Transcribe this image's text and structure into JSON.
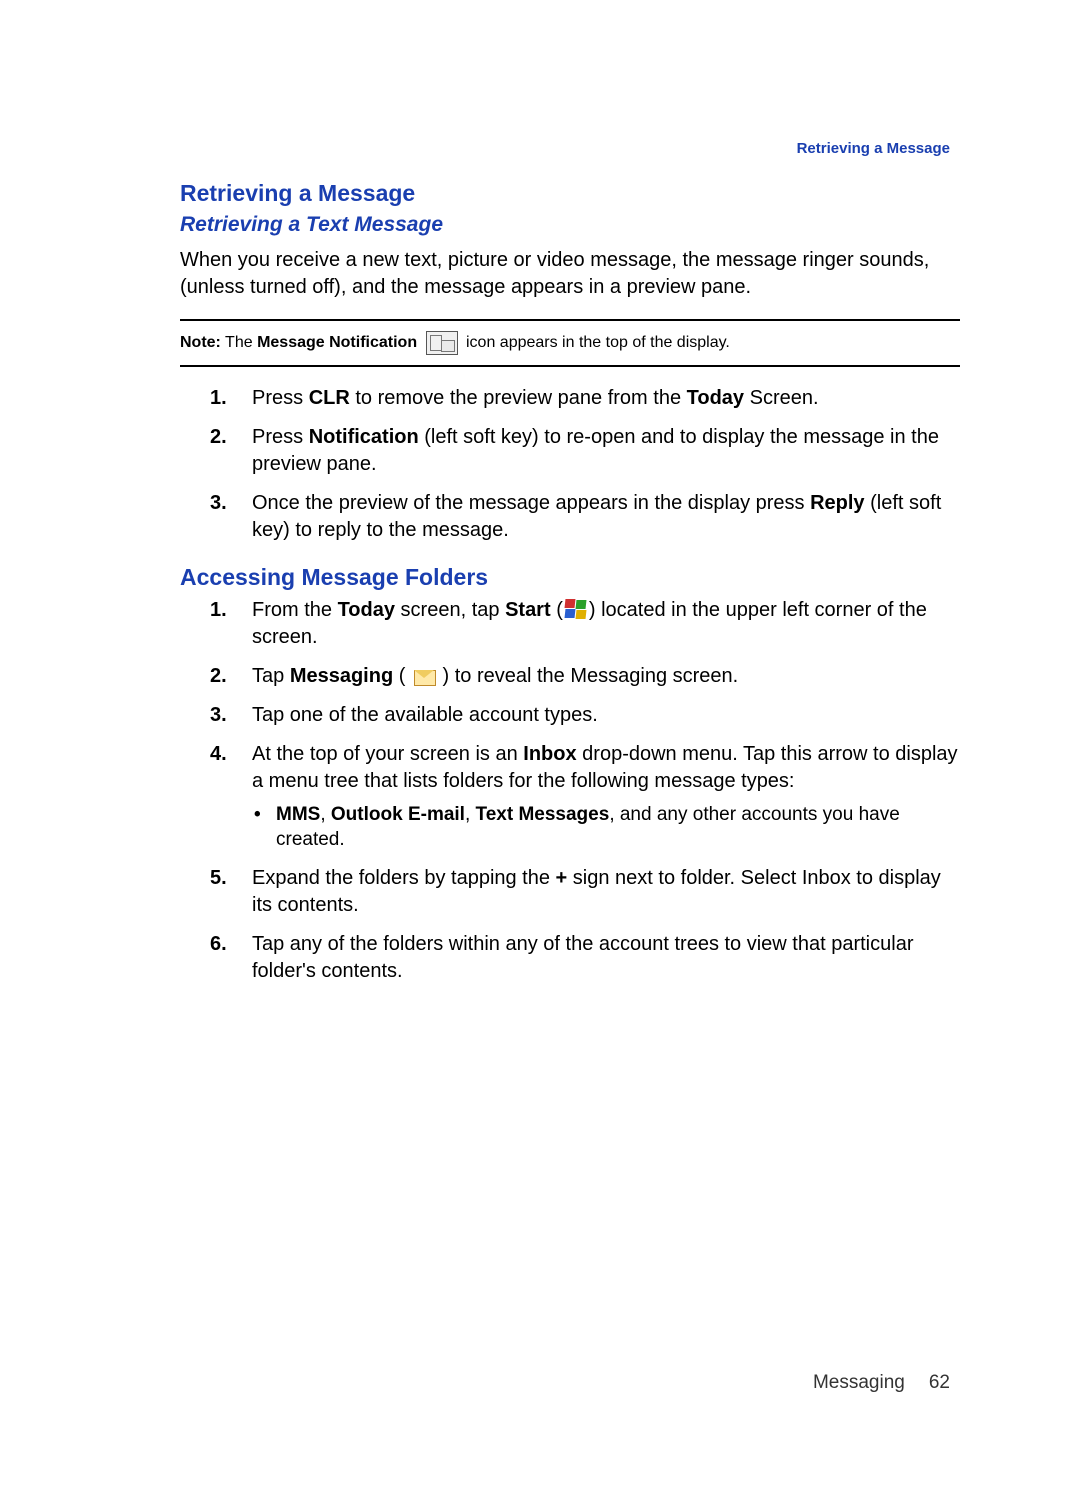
{
  "running_head": "Retrieving a Message",
  "section1": {
    "title": "Retrieving a Message",
    "subtitle": "Retrieving a Text Message",
    "intro": "When you receive a new text, picture or video message, the message ringer sounds, (unless turned off), and the message appears in a preview pane."
  },
  "note": {
    "label": "Note:",
    "before": " The ",
    "bold": "Message Notification",
    "after": " icon appears in the top of the display."
  },
  "steps1": [
    {
      "num": "1.",
      "pre": "Press ",
      "b1": "CLR",
      "mid": " to remove the preview pane from the ",
      "b2": "Today",
      "post": " Screen."
    },
    {
      "num": "2.",
      "pre": "Press ",
      "b1": "Notification",
      "mid": " (left soft key) to re-open and to display the message in the preview pane.",
      "b2": "",
      "post": ""
    },
    {
      "num": "3.",
      "pre": "Once the preview of the message appears in the display press ",
      "b1": "Reply",
      "mid": " (left soft key) to reply to the message.",
      "b2": "",
      "post": ""
    }
  ],
  "section2": {
    "title": "Accessing Message Folders"
  },
  "steps2": [
    {
      "num": "1.",
      "pre": "From the ",
      "b1": "Today",
      "mid": " screen, tap ",
      "b2": "Start",
      "mid2": " (",
      "post": ") located in the upper left corner of the screen.",
      "icon": "start"
    },
    {
      "num": "2.",
      "pre": "Tap ",
      "b1": "Messaging",
      "mid": " ( ",
      "post": " ) to reveal the Messaging screen.",
      "icon": "messaging"
    },
    {
      "num": "3.",
      "text": "Tap one of the available account types."
    },
    {
      "num": "4.",
      "pre": "At the top of your screen is an ",
      "b1": "Inbox",
      "mid": " drop-down menu. Tap this arrow to display a menu tree that lists folders for the following message types:",
      "sub": {
        "b1": "MMS",
        "s1": ", ",
        "b2": "Outlook E-mail",
        "s2": ", ",
        "b3": "Text Messages",
        "tail": ", and any other accounts you have created."
      }
    },
    {
      "num": "5.",
      "pre": "Expand the folders by tapping the ",
      "b1": "+",
      "mid": " sign next to folder. Select Inbox to display its contents."
    },
    {
      "num": "6.",
      "text": "Tap any of the folders within any of the account trees to view that particular folder's contents."
    }
  ],
  "footer": {
    "section": "Messaging",
    "page": "62"
  }
}
